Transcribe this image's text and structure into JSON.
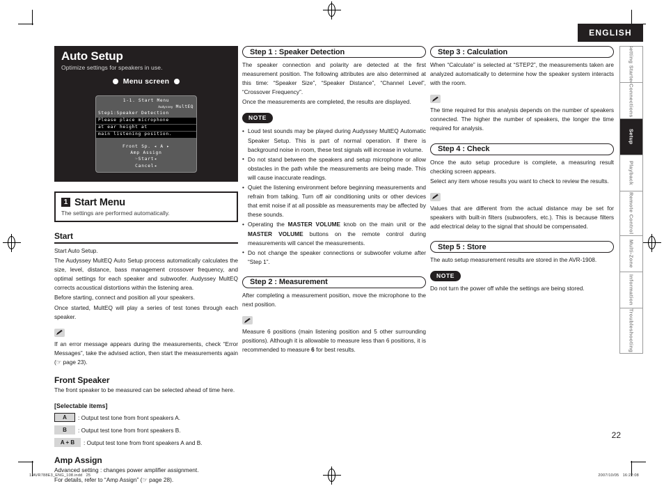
{
  "header": {
    "language_tab": "ENGLISH"
  },
  "side_tabs": [
    {
      "label": "Getting Started",
      "active": false
    },
    {
      "label": "Connections",
      "active": false
    },
    {
      "label": "Setup",
      "active": true
    },
    {
      "label": "Playback",
      "active": false
    },
    {
      "label": "Remote Control",
      "active": false
    },
    {
      "label": "Multi-Zone",
      "active": false
    },
    {
      "label": "Information",
      "active": false
    },
    {
      "label": "Troubleshooting",
      "active": false
    }
  ],
  "banner": {
    "title": "Auto Setup",
    "subtitle": "Optimize settings for speakers in use.",
    "menu_screen_label": "Menu screen"
  },
  "osd": {
    "title": "1-1. Start Menu",
    "brand_small": "Audyssey",
    "brand": "MultEQ",
    "step_line": "Step1:Speaker Detection",
    "highlight_line1": "Please place microphone",
    "highlight_line2": "at ear height at",
    "highlight_line3": "main listening position.",
    "menu_front_sp": "Front Sp. ◂ A ▸",
    "menu_amp_assign": "Amp Assign",
    "menu_start": "☞Start◂",
    "menu_cancel": "Cancel◂"
  },
  "section_1": {
    "number": "1",
    "title": "Start Menu",
    "subtitle": "The settings are performed automatically."
  },
  "start": {
    "heading": "Start",
    "p1": "Start Auto Setup.",
    "p2": "The Audyssey MultEQ Auto Setup process automatically calculates the size, level, distance, bass management crossover frequency, and optimal settings for each speaker and subwoofer. Audyssey MultEQ corrects acoustical distortions within the listening area.",
    "p3": "Before starting, connect and position all your speakers.",
    "p4": "Once started, MultEQ will play a series of test tones through each speaker.",
    "tip": "If an error message appears during the measurements, check “Error Messages”, take the advised action, then start the measurements again (☞ page 23)."
  },
  "front_speaker": {
    "heading": "Front Speaker",
    "body": "The front speaker to be measured can be selected ahead of time here.",
    "selectable_label": "[Selectable items]",
    "items": [
      {
        "key": "A",
        "desc": ": Output test tone from front speakers A.",
        "outlined": true
      },
      {
        "key": "B",
        "desc": ": Output test tone from front speakers B.",
        "outlined": false
      },
      {
        "key": "A + B",
        "desc": ": Output test tone from front speakers A and B.",
        "outlined": false
      }
    ]
  },
  "amp_assign": {
    "heading": "Amp Assign",
    "p1": "Advanced setting : changes power amplifier assignment.",
    "p2": "For details, refer to “Amp Assign” (☞ page 28)."
  },
  "step1": {
    "title": "Step 1 : Speaker Detection",
    "p1": "The speaker connection and polarity are detected at the first measurement position. The following attributes are also determined at this time: “Speaker Size”, “Speaker Distance”, “Channel Level”, “Crossover Frequency”.",
    "p2": "Once the measurements are completed, the results are displayed.",
    "note_label": "NOTE",
    "notes": [
      "Loud test sounds may be played during Audyssey MultEQ Automatic Speaker Setup. This is part of normal operation. If there is background noise in room, these test signals will increase in volume.",
      "Do not stand between the speakers and setup microphone or allow obstacles in the path while the measurements are being made. This will cause inaccurate readings.",
      "Quiet the listening environment before beginning measurements and refrain from talking. Turn off air conditioning units or other devices that emit noise if at all possible as measurements may be affected by these sounds.",
      "Do not change the speaker connections or subwoofer volume after “Step 1”."
    ],
    "note_master_volume": {
      "pre": "Operating the ",
      "b1": "MASTER VOLUME",
      "mid": " knob on the main unit or the ",
      "b2": "MASTER VOLUME",
      "post": " buttons on the remote control during measurements will cancel the measurements."
    }
  },
  "step2": {
    "title": "Step 2 : Measurement",
    "p1": "After completing a measurement position, move the microphone to the next position.",
    "tip_pre": "Measure 6 positions (main listening position and 5 other surrounding positions). Although it is allowable to measure less than 6 positions, it is recommended to measure ",
    "tip_bold": "6",
    "tip_post": " for best results."
  },
  "step3": {
    "title": "Step 3 : Calculation",
    "p1": "When “Calculate” is selected at “STEP2”, the measurements taken are analyzed automatically to determine how the speaker system interacts with the room.",
    "tip": "The time required for this analysis depends on the number of speakers connected. The higher the number of speakers, the longer the time required for analysis."
  },
  "step4": {
    "title": "Step 4 : Check",
    "p1": "Once the auto setup procedure is complete, a measuring result checking screen appears.",
    "p2": "Select any item whose results you want to check to review the results.",
    "tip": "Values that are different from the actual distance may be set for speakers with built-in filters (subwoofers, etc.). This is because filters add electrical delay to the signal that should be compensated."
  },
  "step5": {
    "title": "Step 5 : Store",
    "p1": "The auto setup measurement results are stored in the AVR-1908.",
    "note_label": "NOTE",
    "note": "Do not turn the power off while the settings are being stored."
  },
  "page_number": "22",
  "footer": {
    "left": "1.AVR788E3_ENG_108.indd   25",
    "right": "2007/10/05   16:22:08"
  }
}
